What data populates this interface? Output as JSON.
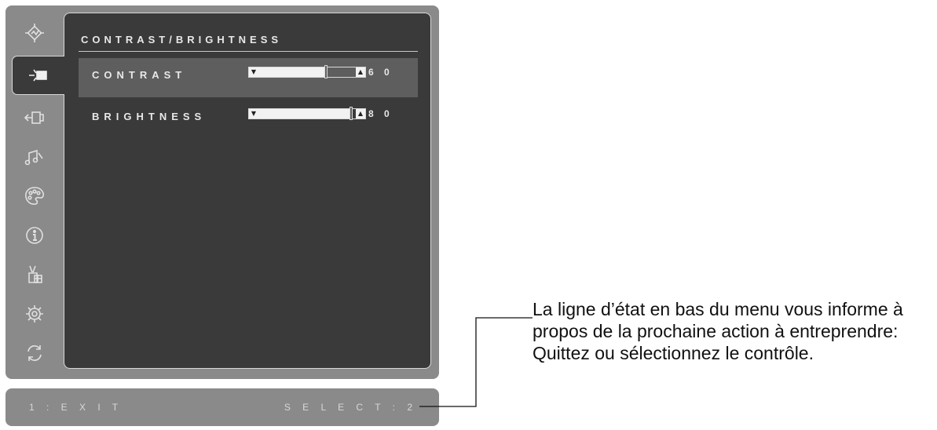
{
  "osd": {
    "title": "CONTRAST/BRIGHTNESS",
    "sidebar": [
      {
        "icon": "auto-image-adjust-icon",
        "active": false
      },
      {
        "icon": "contrast-brightness-icon",
        "active": true
      },
      {
        "icon": "input-select-icon",
        "active": false
      },
      {
        "icon": "audio-adjust-icon",
        "active": false
      },
      {
        "icon": "color-adjust-icon",
        "active": false
      },
      {
        "icon": "information-icon",
        "active": false
      },
      {
        "icon": "manual-image-adjust-icon",
        "active": false
      },
      {
        "icon": "setup-menu-icon",
        "active": false
      },
      {
        "icon": "memory-recall-icon",
        "active": false
      }
    ],
    "rows": [
      {
        "label": "CONTRAST",
        "value": "6 0",
        "level": 0.6,
        "selected": true
      },
      {
        "label": "BRIGHTNESS",
        "value": "8 0",
        "level": 0.8,
        "selected": false
      }
    ]
  },
  "status": {
    "exit": "1 : E X I T",
    "select": "S E L E C T : 2"
  },
  "callout": {
    "text": "La ligne d’état en bas du menu vous informe à propos de la prochaine action à entreprendre: Quittez ou sélectionnez le contrôle."
  },
  "colors": {
    "frame": "#8a8a8a",
    "panel": "#3a3a3a",
    "selected_row": "#5e5e5e",
    "text": "#e8e8e8"
  }
}
